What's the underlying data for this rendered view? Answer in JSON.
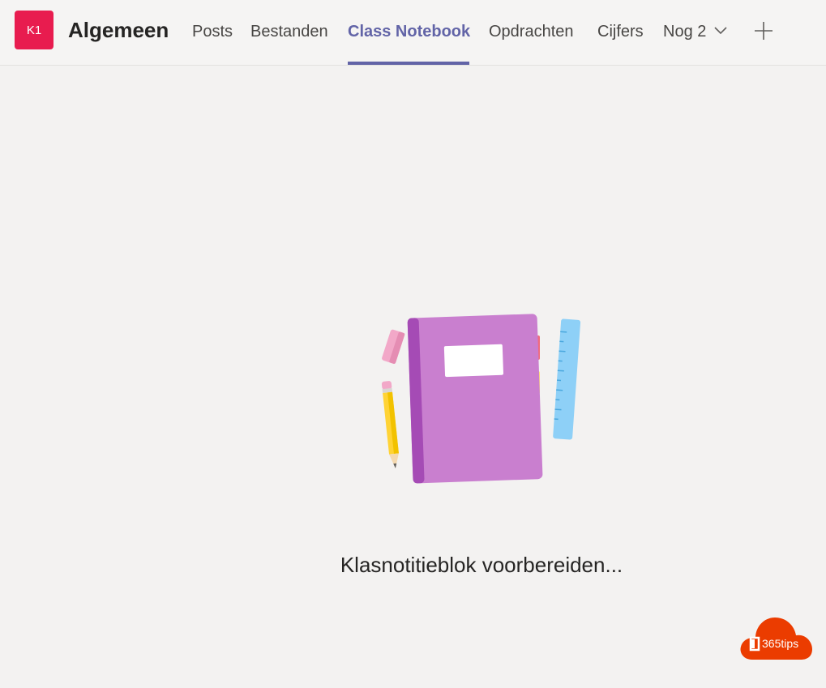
{
  "team": {
    "avatar_initials": "K1",
    "avatar_color": "#e81c4f",
    "channel_name": "Algemeen"
  },
  "tabs": [
    {
      "label": "Posts",
      "active": false
    },
    {
      "label": "Bestanden",
      "active": false
    },
    {
      "label": "Class Notebook",
      "active": true
    },
    {
      "label": "Opdrachten",
      "active": false
    },
    {
      "label": "Cijfers",
      "active": false
    },
    {
      "label": "Nog 2",
      "active": false
    }
  ],
  "icons": {
    "more_tabs": "chevron-down-icon",
    "add_tab": "plus-icon",
    "illustration": "notebook-illustration"
  },
  "accent_color": "#6264a7",
  "loading": {
    "message": "Klasnotitieblok voorbereiden..."
  },
  "watermark": {
    "text": "365tips",
    "color": "#eb3c00"
  }
}
